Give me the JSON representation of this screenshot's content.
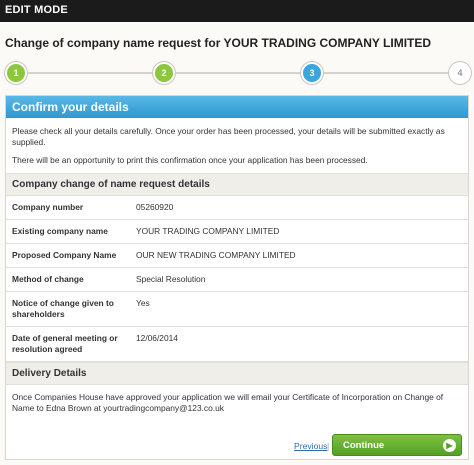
{
  "topbar": {
    "label": "EDIT MODE"
  },
  "page_title": "Change of company name request for YOUR TRADING COMPANY LIMITED",
  "steps": [
    {
      "number": "1",
      "state": "done"
    },
    {
      "number": "2",
      "state": "done"
    },
    {
      "number": "3",
      "state": "current"
    },
    {
      "number": "4",
      "state": "todo"
    }
  ],
  "confirm": {
    "title": "Confirm your details",
    "intro_1": "Please check all your details carefully. Once your order has been processed, your details will be submitted exactly as supplied.",
    "intro_2": "There will be an opportunity to print this confirmation once your application has been processed."
  },
  "details": {
    "title": "Company change of name request details",
    "rows": [
      {
        "label": "Company number",
        "value": "05260920"
      },
      {
        "label": "Existing company name",
        "value": "YOUR TRADING COMPANY LIMITED"
      },
      {
        "label": "Proposed Company Name",
        "value": "OUR NEW TRADING COMPANY LIMITED"
      },
      {
        "label": "Method of change",
        "value": "Special Resolution"
      },
      {
        "label": "Notice of change given to shareholders",
        "value": "Yes"
      },
      {
        "label": "Date of general meeting or resolution agreed",
        "value": "12/06/2014"
      }
    ]
  },
  "delivery": {
    "title": "Delivery Details",
    "text": "Once Companies House have approved your application we will email your Certificate of Incorporation on Change of Name to Edna Brown at yourtradingcompany@123.co.uk"
  },
  "footer": {
    "previous_label": "Previous",
    "separator": "|",
    "continue_label": "Continue",
    "continue_icon": "arrow-right-circle-icon"
  },
  "colors": {
    "accent_blue": "#3aa6dd",
    "accent_green": "#8dc63f",
    "button_green": "#54a024"
  }
}
